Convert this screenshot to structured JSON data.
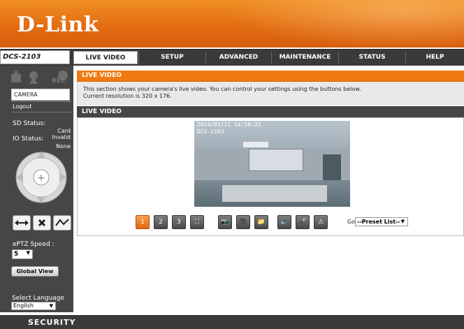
{
  "brand": {
    "logo": "D-Link",
    "model": "DCS-2103"
  },
  "nav": {
    "tabs": [
      "LIVE VIDEO",
      "SETUP",
      "ADVANCED",
      "MAINTENANCE",
      "STATUS",
      "HELP"
    ],
    "active": "LIVE VIDEO"
  },
  "sidebar": {
    "menu_camera": "CAMERA",
    "logout": "Logout",
    "rec_label": "REC",
    "sd_status_label": "SD Status:",
    "sd_status_value": "Card Invalid",
    "io_status_label": "IO Status:",
    "io_status_value": "None",
    "eptz_label": "ePTZ Speed :",
    "eptz_value": "5",
    "global_view": "Global View",
    "language_label": "Select Language",
    "language_value": "English",
    "icons": [
      "motion-icon",
      "sound-icon",
      "rec-icon"
    ]
  },
  "main": {
    "section_title": "LIVE VIDEO",
    "description": "This section shows your camera's live video. You can control your settings using the buttons below.",
    "resolution": "Current resolution is 320 x 176.",
    "live_title": "LIVE VIDEO",
    "video_timestamp": "2014/01/11 14:56:22",
    "video_camera": "DCS-2103",
    "goto_label": "GoTo",
    "preset_value": "--Preset List--",
    "toolbar": [
      {
        "name": "view-1x-button",
        "label": "1"
      },
      {
        "name": "view-2x-button",
        "label": "2"
      },
      {
        "name": "view-3x-button",
        "label": "3"
      },
      {
        "name": "fullscreen-button",
        "label": "⛶"
      },
      {
        "name": "snapshot-button",
        "label": "📷"
      },
      {
        "name": "record-button",
        "label": "🎥"
      },
      {
        "name": "folder-button",
        "label": "📁"
      },
      {
        "name": "speaker-button",
        "label": "🔈"
      },
      {
        "name": "mic-button",
        "label": "🎤"
      },
      {
        "name": "alarm-button",
        "label": "⚠"
      }
    ]
  },
  "footer": {
    "label": "SECURITY"
  },
  "colors": {
    "accent": "#f07a12",
    "dark": "#464646"
  }
}
